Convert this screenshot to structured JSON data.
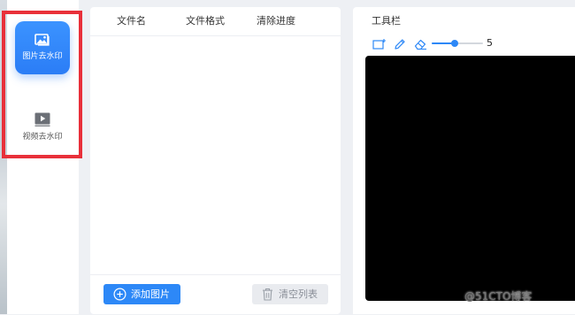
{
  "sidebar": {
    "items": [
      {
        "label": "图片去水印",
        "icon": "image-icon",
        "active": true
      },
      {
        "label": "视频去水印",
        "icon": "video-play-icon",
        "active": false
      }
    ]
  },
  "file_list": {
    "columns": [
      "文件名",
      "文件格式",
      "清除进度"
    ],
    "rows": [],
    "add_button": "添加图片",
    "clear_button": "清空列表"
  },
  "toolbar": {
    "title": "工具栏",
    "tools": [
      "rectangle-select-icon",
      "pencil-icon",
      "eraser-icon"
    ],
    "brush_size": 5,
    "brush_size_fraction": 0.45
  },
  "colors": {
    "accent": "#2d88f7",
    "highlight_frame": "#e8303a",
    "canvas": "#000000"
  },
  "watermark": "@51CTO博客"
}
